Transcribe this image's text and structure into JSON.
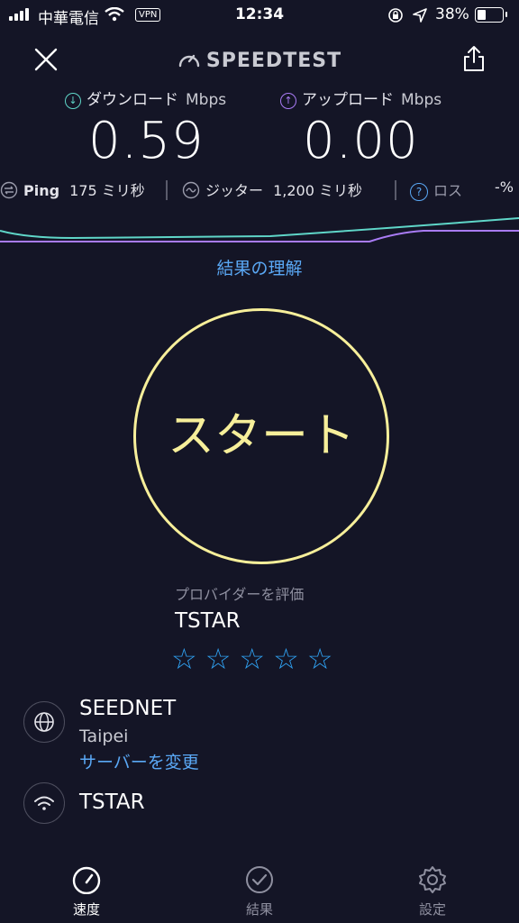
{
  "status_bar": {
    "carrier": "中華電信",
    "vpn": "VPN",
    "time": "12:34",
    "battery": "38%",
    "battery_level": 0.38
  },
  "header": {
    "logo": "SPEEDTEST",
    "close_icon": "close-icon",
    "share_icon": "share-icon"
  },
  "download": {
    "label": "ダウンロード",
    "unit": "Mbps",
    "value": "0.59",
    "color": "#5fd6c8"
  },
  "upload": {
    "label": "アップロード",
    "unit": "Mbps",
    "value": "0.00",
    "color": "#a97bf5"
  },
  "stats": {
    "ping_label": "Ping",
    "ping_value": "175 ミリ秒",
    "jitter_label": "ジッター",
    "jitter_value": "1,200 ミリ秒",
    "loss_label": "ロス",
    "loss_value": "-%"
  },
  "understand_link": "結果の理解",
  "start_button": "スタート",
  "rating": {
    "prompt": "プロバイダーを評価",
    "provider": "TSTAR",
    "stars": "☆☆☆☆☆"
  },
  "server": {
    "name": "SEEDNET",
    "location": "Taipei",
    "change_link": "サーバーを変更"
  },
  "connection": {
    "provider": "TSTAR"
  },
  "tabs": [
    {
      "label": "速度",
      "icon": "speedometer-icon",
      "active": true
    },
    {
      "label": "結果",
      "icon": "checkmark-circle-icon",
      "active": false
    },
    {
      "label": "設定",
      "icon": "gear-icon",
      "active": false
    }
  ],
  "colors": {
    "background": "#141526",
    "accent_yellow": "#f7ef9a",
    "link_blue": "#5aa8f5",
    "download": "#5fd6c8",
    "upload": "#a97bf5"
  }
}
